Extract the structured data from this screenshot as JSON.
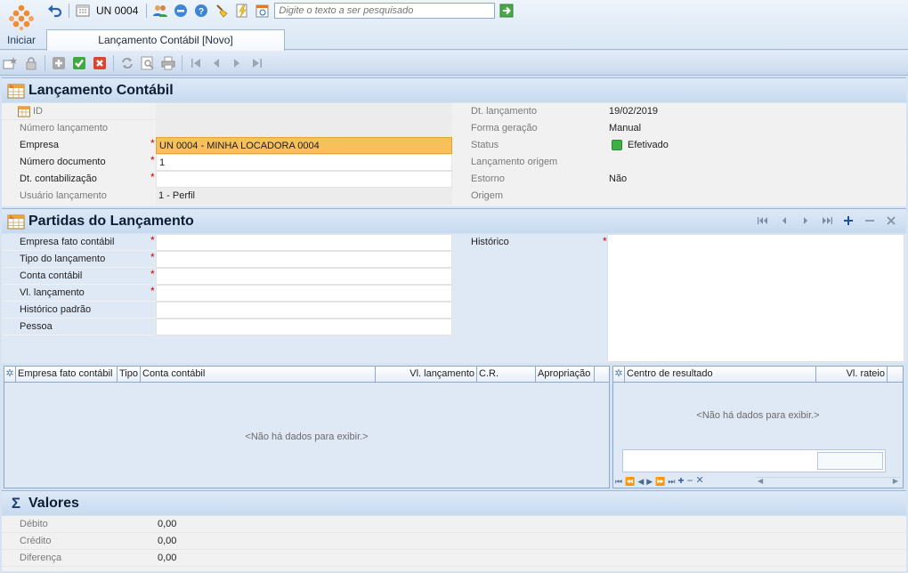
{
  "start": {
    "label": "Iniciar"
  },
  "quickbar": {
    "unit": "UN 0004",
    "search_placeholder": "Digite o texto a ser pesquisado"
  },
  "tab": {
    "label": "Lançamento Contábil [Novo]"
  },
  "lancamento": {
    "title": "Lançamento Contábil",
    "left": [
      {
        "label": "ID",
        "value": "",
        "required": false
      },
      {
        "label": "Número lançamento",
        "value": "",
        "required": false
      },
      {
        "label": "Empresa",
        "value": "UN 0004 - MINHA LOCADORA 0004",
        "required": true
      },
      {
        "label": "Número documento",
        "value": "1",
        "required": true
      },
      {
        "label": "Dt. contabilização",
        "value": "",
        "required": true
      },
      {
        "label": "Usuário lançamento",
        "value": "1 - Perfil",
        "required": false
      }
    ],
    "right": [
      {
        "label": "Dt. lançamento",
        "value": "19/02/2019"
      },
      {
        "label": "Forma geração",
        "value": "Manual"
      },
      {
        "label": "Status",
        "value": "Efetivado"
      },
      {
        "label": "Lançamento origem",
        "value": ""
      },
      {
        "label": "Estorno",
        "value": "Não"
      },
      {
        "label": "Origem",
        "value": ""
      }
    ]
  },
  "partidas": {
    "title": "Partidas do Lançamento",
    "fields": [
      {
        "label": "Empresa fato contábil",
        "required": true
      },
      {
        "label": "Tipo do lançamento",
        "required": true
      },
      {
        "label": "Conta contábil",
        "required": true
      },
      {
        "label": "Vl. lançamento",
        "required": true
      },
      {
        "label": "Histórico padrão",
        "required": false
      },
      {
        "label": "Pessoa",
        "required": false
      }
    ],
    "historico_label": "Histórico",
    "grid_columns": [
      "Empresa fato contábil",
      "Tipo",
      "Conta contábil",
      "Vl. lançamento",
      "C.R.",
      "Apropriação"
    ],
    "grid_empty": "<Não há dados para exibir.>",
    "cr_columns": [
      "Centro de resultado",
      "Vl. rateio"
    ],
    "cr_empty": "<Não há dados para exibir.>"
  },
  "valores": {
    "title": "Valores",
    "rows": [
      {
        "label": "Débito",
        "value": "0,00"
      },
      {
        "label": "Crédito",
        "value": "0,00"
      },
      {
        "label": "Diferença",
        "value": "0,00"
      }
    ]
  },
  "colors": {
    "accent": "#f08c2c",
    "status_green": "#3cb043",
    "required": "#d10000",
    "selected_field": "#f8c05b"
  }
}
